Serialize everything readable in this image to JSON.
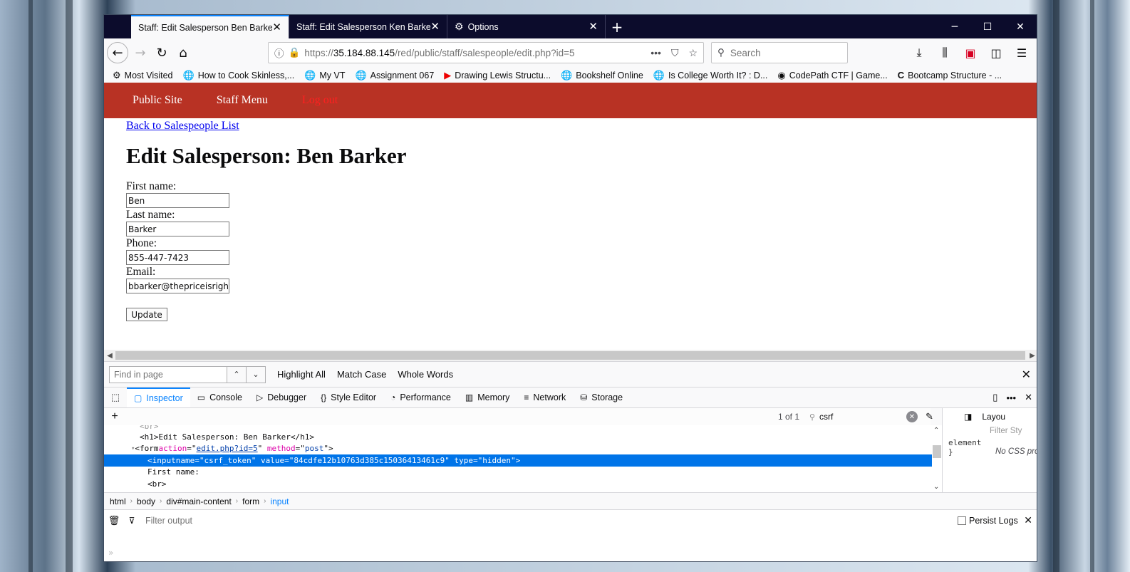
{
  "tabs": [
    {
      "label": "Staff: Edit Salesperson Ben Barker",
      "active": true
    },
    {
      "label": "Staff: Edit Salesperson Ken Barker",
      "active": false
    },
    {
      "label": "Options",
      "active": false
    }
  ],
  "url": {
    "scheme": "https://",
    "host": "35.184.88.145",
    "path": "/red/public/staff/salespeople/edit.php?id=5"
  },
  "search_placeholder": "Search",
  "bookmarks": [
    {
      "label": "Most Visited",
      "icon": "gear-icon"
    },
    {
      "label": "How to Cook Skinless,...",
      "icon": "globe-icon"
    },
    {
      "label": "My VT",
      "icon": "globe-icon"
    },
    {
      "label": "Assignment 067",
      "icon": "globe-icon"
    },
    {
      "label": "Drawing Lewis Structu...",
      "icon": "youtube-icon"
    },
    {
      "label": "Bookshelf Online",
      "icon": "globe-icon"
    },
    {
      "label": "Is College Worth It? : D...",
      "icon": "globe-icon"
    },
    {
      "label": "CodePath CTF | Game...",
      "icon": "codepath-icon"
    },
    {
      "label": "Bootcamp Structure - ...",
      "icon": "c-icon"
    }
  ],
  "site": {
    "nav": [
      "Public Site",
      "Staff Menu",
      "Log out"
    ],
    "back_link": "Back to Salespeople List",
    "heading": "Edit Salesperson: Ben Barker",
    "fields": [
      {
        "label": "First name:",
        "value": "Ben"
      },
      {
        "label": "Last name:",
        "value": "Barker"
      },
      {
        "label": "Phone:",
        "value": "855-447-7423"
      },
      {
        "label": "Email:",
        "value": "bbarker@thepriceisright."
      }
    ],
    "update_button": "Update"
  },
  "findbar": {
    "placeholder": "Find in page",
    "options": [
      "Highlight All",
      "Match Case",
      "Whole Words"
    ]
  },
  "devtools": {
    "tabs": [
      "Inspector",
      "Console",
      "Debugger",
      "Style Editor",
      "Performance",
      "Memory",
      "Network",
      "Storage"
    ],
    "search_count": "1 of 1",
    "search_term": "csrf",
    "layout_label": "Layou",
    "filter_styles": "Filter Sty",
    "element_label": "element",
    "element_brace": "}",
    "no_css": "No CSS prop",
    "markup": {
      "line_top": "<br>",
      "h1_open": "<h1>",
      "h1_text": "Edit Salesperson: Ben Barker",
      "h1_close": "</h1>",
      "form_tag": "<form",
      "form_action_attr": "action",
      "form_action_val": "edit.php?id=5",
      "form_method_attr": "method",
      "form_method_val": "post",
      "input_tag": "<input",
      "input_name_attr": "name",
      "input_name_val": "csrf_token",
      "input_value_attr": "value",
      "input_value_val": "84cdfe12b10763d385c15036413461c9",
      "input_type_attr": "type",
      "input_type_val": "hidden",
      "first_name_text": "First name:",
      "br": "<br>"
    },
    "breadcrumbs": [
      "html",
      "body",
      "div#main-content",
      "form",
      "input"
    ],
    "console_filter": "Filter output",
    "persist_logs": "Persist Logs"
  }
}
